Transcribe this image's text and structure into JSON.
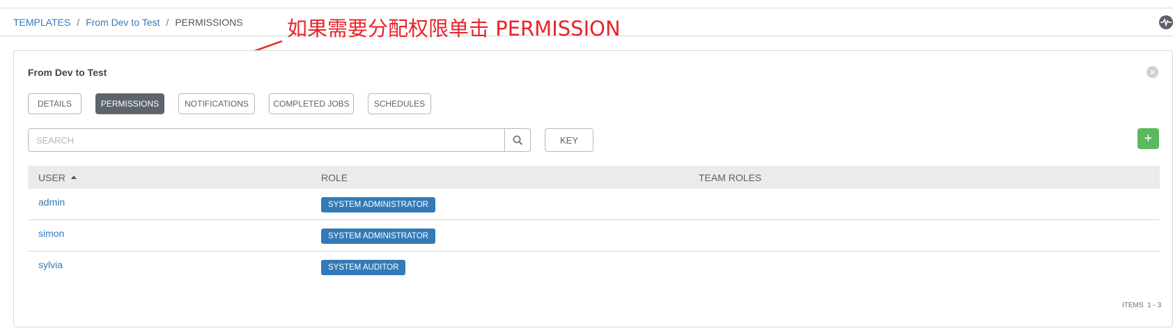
{
  "breadcrumb": {
    "items": [
      "TEMPLATES",
      "From Dev to Test",
      "PERMISSIONS"
    ],
    "separator": "/"
  },
  "annotation": {
    "text": "如果需要分配权限单击 PERMISSION",
    "color": "#e8232a"
  },
  "panel": {
    "title": "From Dev to Test"
  },
  "tabs": [
    {
      "label": "DETAILS",
      "active": false
    },
    {
      "label": "PERMISSIONS",
      "active": true
    },
    {
      "label": "NOTIFICATIONS",
      "active": false
    },
    {
      "label": "COMPLETED JOBS",
      "active": false
    },
    {
      "label": "SCHEDULES",
      "active": false
    }
  ],
  "search": {
    "placeholder": "SEARCH",
    "value": ""
  },
  "toolbar": {
    "key_label": "KEY",
    "add_label": "+"
  },
  "table": {
    "columns": [
      "USER",
      "ROLE",
      "TEAM ROLES"
    ],
    "sort_column": "USER",
    "sort_direction": "ascending",
    "rows": [
      {
        "user": "admin",
        "role": "SYSTEM ADMINISTRATOR",
        "team_roles": ""
      },
      {
        "user": "simon",
        "role": "SYSTEM ADMINISTRATOR",
        "team_roles": ""
      },
      {
        "user": "sylvia",
        "role": "SYSTEM AUDITOR",
        "team_roles": ""
      }
    ]
  },
  "pagination": {
    "items_label": "ITEMS",
    "range": "1 - 3"
  },
  "colors": {
    "link": "#337ab7",
    "active_tab": "#5d646c",
    "add_button": "#5cb85c",
    "role_badge": "#337ab7"
  },
  "icons": {
    "activity": "activity-stream-icon",
    "close": "close-icon",
    "search": "search-icon",
    "sort": "sort-ascending-icon"
  }
}
